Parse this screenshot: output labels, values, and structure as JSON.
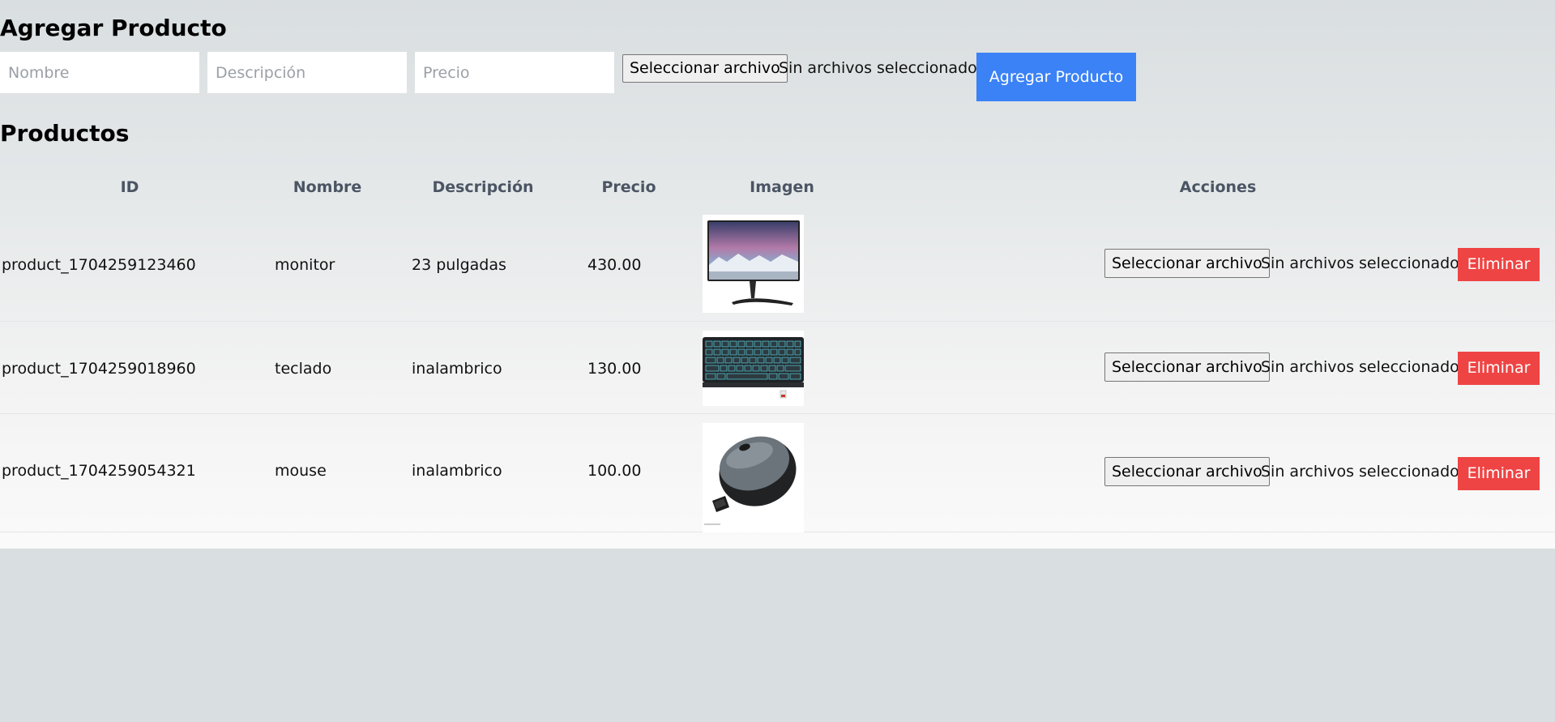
{
  "form": {
    "title": "Agregar Producto",
    "nombre_placeholder": "Nombre",
    "descripcion_placeholder": "Descripción",
    "precio_placeholder": "Precio",
    "file_button": "Seleccionar archivo",
    "file_status": "Sin archivos seleccionados",
    "submit_label": "Agregar Producto"
  },
  "products": {
    "title": "Productos",
    "columns": [
      "ID",
      "Nombre",
      "Descripción",
      "Precio",
      "Imagen",
      "Acciones"
    ],
    "rows": [
      {
        "id": "product_1704259123460",
        "nombre": "monitor",
        "descripcion": "23 pulgadas",
        "precio": "430.00",
        "image": "monitor-image"
      },
      {
        "id": "product_1704259018960",
        "nombre": "teclado",
        "descripcion": "inalambrico",
        "precio": "130.00",
        "image": "keyboard-image"
      },
      {
        "id": "product_1704259054321",
        "nombre": "mouse",
        "descripcion": "inalambrico",
        "precio": "100.00",
        "image": "mouse-image"
      }
    ],
    "actions": {
      "file_button": "Seleccionar archivo",
      "file_status": "Sin archivos seleccionados",
      "delete_label": "Eliminar"
    }
  },
  "colors": {
    "page_background": "#d9dee0",
    "primary_button": "#3b82f6",
    "danger_button": "#ef4444",
    "header_text": "#4b5563"
  }
}
